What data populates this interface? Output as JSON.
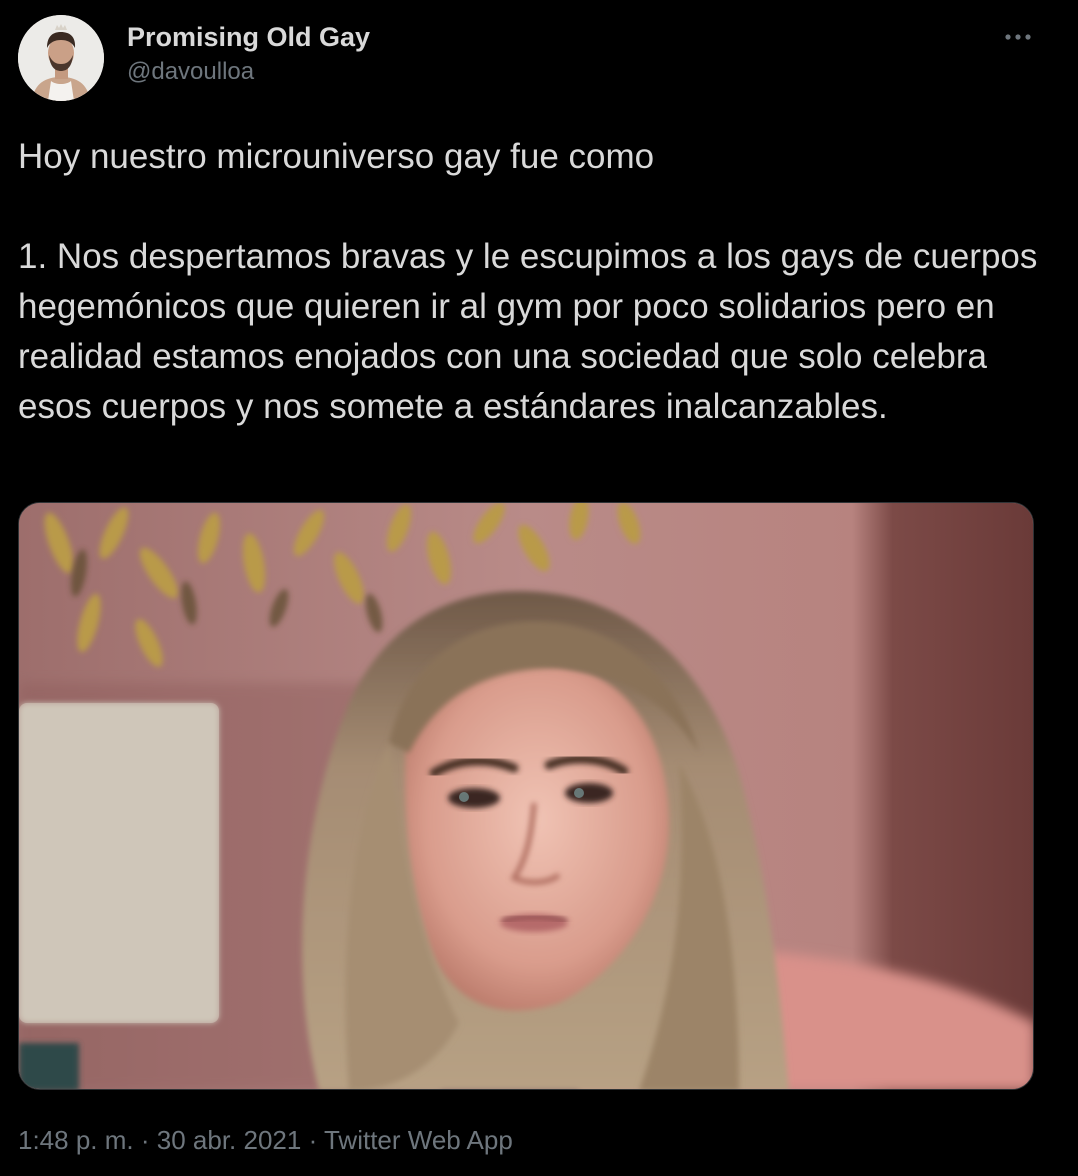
{
  "author": {
    "display_name": "Promising Old Gay",
    "handle": "@davoulloa",
    "avatar_icon": "profile-photo"
  },
  "more_icon": "more-horizontal-icon",
  "tweet": {
    "text": "Hoy nuestro microuniverso gay fue como\n\n1. Nos despertamos bravas y le escupimos a los gays de cuerpos hegemónicos que quieren ir al gym por poco solidarios pero en realidad estamos enojados con una sociedad que solo celebra esos cuerpos y nos somete a estándares inalcanzables."
  },
  "media": {
    "kind": "photo"
  },
  "meta": {
    "time": "1:48 p. m.",
    "separator": "·",
    "date": "30 abr. 2021",
    "source": "Twitter Web App"
  },
  "colors": {
    "background": "#000000",
    "text_primary": "#d9d9d9",
    "text_secondary": "#6e767d",
    "border": "#2f3336"
  }
}
